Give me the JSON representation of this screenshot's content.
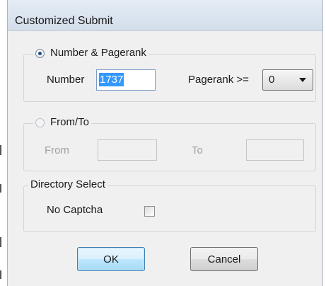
{
  "window": {
    "title": "Customized Submit"
  },
  "group_number_pagerank": {
    "radio_label": "Number & Pagerank",
    "radio_checked": true,
    "number_label": "Number",
    "number_value": "1737",
    "pagerank_label": "Pagerank >=",
    "pagerank_value": "0"
  },
  "group_from_to": {
    "radio_label": "From/To",
    "radio_checked": false,
    "from_label": "From",
    "from_value": "",
    "to_label": "To",
    "to_value": ""
  },
  "group_directory": {
    "legend": "Directory Select",
    "no_captcha_label": "No Captcha",
    "no_captcha_checked": false
  },
  "buttons": {
    "ok_label": "OK",
    "cancel_label": "Cancel"
  },
  "colors": {
    "window_bg": "#f0f0f0",
    "selection": "#3399ff",
    "disabled_text": "#a0a0a0"
  }
}
